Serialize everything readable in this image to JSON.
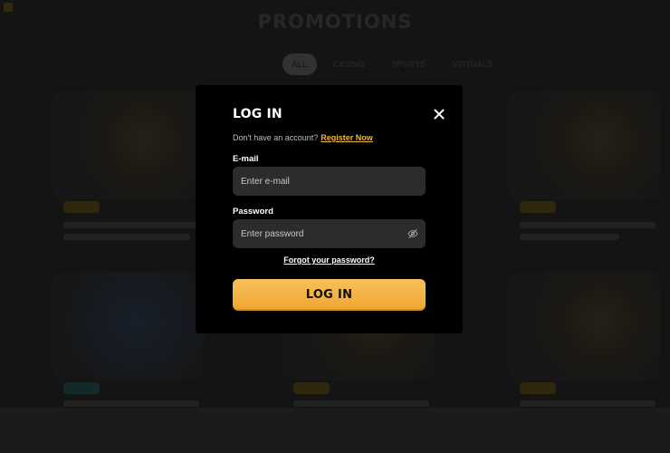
{
  "background": {
    "page_title": "PROMOTIONS",
    "filter_tabs": [
      {
        "label": "ALL",
        "active": true
      },
      {
        "label": "CASINO",
        "active": false
      },
      {
        "label": "SPORTS",
        "active": false
      },
      {
        "label": "VIRTUALS",
        "active": false
      }
    ]
  },
  "login_modal": {
    "title": "LOG IN",
    "register_prompt": "Don't have an account?",
    "register_link": "Register Now",
    "email": {
      "label": "E-mail",
      "placeholder": "Enter e-mail",
      "value": ""
    },
    "password": {
      "label": "Password",
      "placeholder": "Enter password",
      "value": ""
    },
    "forgot_password": "Forgot your password?",
    "submit_label": "LOG IN",
    "icons": {
      "close": "close-icon",
      "password_visibility": "eye-slash-icon"
    }
  },
  "colors": {
    "accent_link": "#f1b83a",
    "button_gradient_top": "#f7c05a",
    "button_gradient_bottom": "#f0a630",
    "modal_bg": "#000000",
    "input_bg": "#2c2c2c"
  }
}
